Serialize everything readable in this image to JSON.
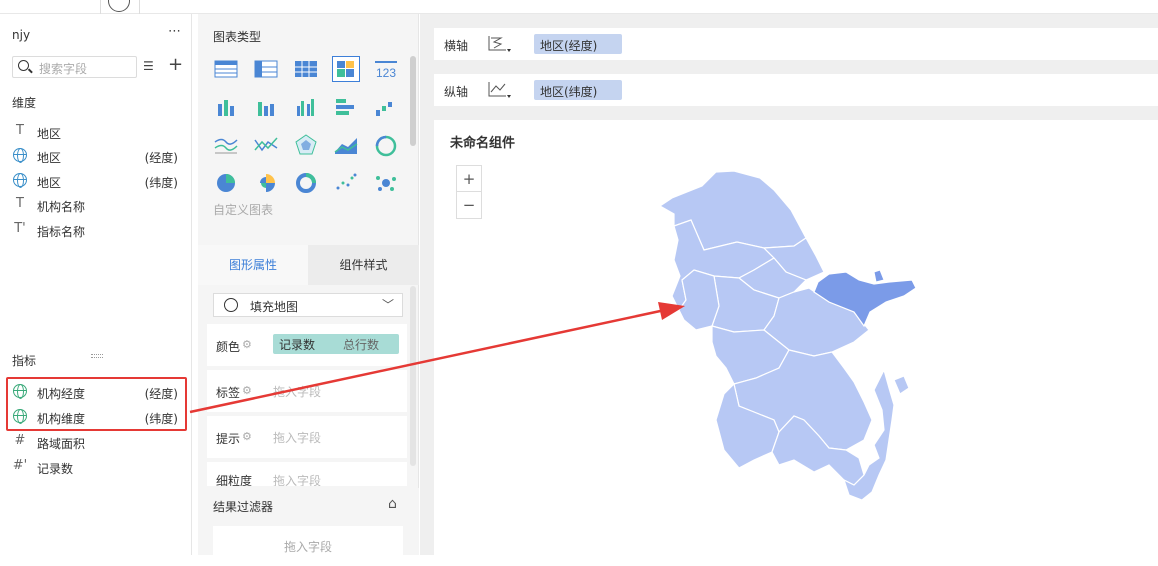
{
  "left": {
    "dataset": "njy",
    "more_icon": "more-icon",
    "search_placeholder": "搜索字段",
    "dimensions_title": "维度",
    "dimensions": [
      {
        "name": "地区",
        "tag": "",
        "icon": "text-icon"
      },
      {
        "name": "地区",
        "tag": "(经度)",
        "icon": "globe-icon"
      },
      {
        "name": "地区",
        "tag": "(纬度)",
        "icon": "globe-icon"
      },
      {
        "name": "机构名称",
        "tag": "",
        "icon": "text-icon"
      },
      {
        "name": "指标名称",
        "tag": "",
        "icon": "text-icon"
      }
    ],
    "metrics_title": "指标",
    "metrics": [
      {
        "name": "机构经度",
        "tag": "(经度)",
        "icon": "globe-icon"
      },
      {
        "name": "机构维度",
        "tag": "(纬度)",
        "icon": "globe-icon"
      },
      {
        "name": "路域面积",
        "tag": "",
        "icon": "number-icon"
      },
      {
        "name": "记录数",
        "tag": "",
        "icon": "number-icon"
      }
    ]
  },
  "mid": {
    "chart_types_title": "图表类型",
    "custom_chart": "自定义图表",
    "tab_shape": "图形属性",
    "tab_style": "组件样式",
    "map_type": "填充地图",
    "props": {
      "color": "颜色",
      "color_field": "记录数",
      "color_field2": "总行数",
      "label": "标签",
      "tooltip": "提示",
      "granularity": "细粒度",
      "drop_hint": "拖入字段"
    },
    "filter_title": "结果过滤器",
    "filter_drop": "拖入字段"
  },
  "right": {
    "x_axis_label": "横轴",
    "x_axis_field": "地区(经度)",
    "y_axis_label": "纵轴",
    "y_axis_field": "地区(纬度)",
    "widget_title": "未命名组件",
    "zoom_in": "+",
    "zoom_out": "−"
  },
  "colors": {
    "map_fill": "#b7c8f4",
    "map_highlight": "#7b9be8",
    "accent": "#3d7fd8",
    "annotation": "#e53935"
  }
}
